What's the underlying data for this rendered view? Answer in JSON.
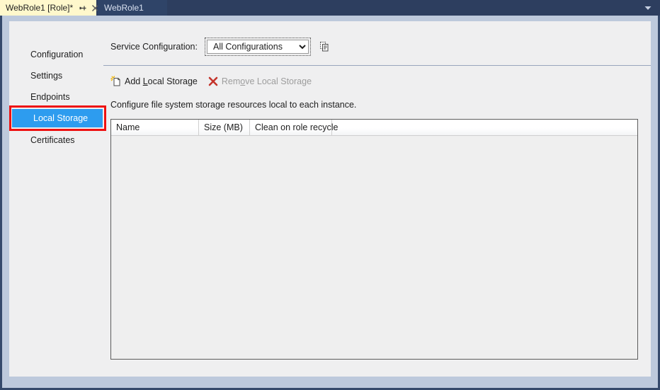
{
  "window": {
    "tabs": [
      {
        "label": "WebRole1 [Role]*",
        "active": true,
        "pin_icon": "pin-icon",
        "close_icon": "close-icon"
      },
      {
        "label": "WebRole1",
        "active": false
      }
    ],
    "overflow_icon": "chevron-down-icon"
  },
  "left_nav": {
    "items": [
      {
        "label": "Configuration",
        "selected": false
      },
      {
        "label": "Settings",
        "selected": false
      },
      {
        "label": "Endpoints",
        "selected": false
      },
      {
        "label": "Local Storage",
        "selected": true
      },
      {
        "label": "Certificates",
        "selected": false
      }
    ],
    "selected_highlight_color": "#2d9cef",
    "annotation_color": "#ee1111"
  },
  "service_configuration": {
    "label": "Service Configuration:",
    "selected_value": "All Configurations",
    "options": [
      "All Configurations"
    ],
    "copy_icon": "copy-icon"
  },
  "toolbar": {
    "add_label_prefix": "Add ",
    "add_label_accel": "L",
    "add_label_suffix": "ocal Storage",
    "add_icon": "add-document-icon",
    "remove_label_prefix": "Rem",
    "remove_label_accel": "o",
    "remove_label_suffix": "ve Local Storage",
    "remove_icon": "red-x-icon",
    "remove_enabled": false
  },
  "description": "Configure file system storage resources local to each instance.",
  "grid": {
    "columns": [
      "Name",
      "Size (MB)",
      "Clean on role recycle"
    ],
    "rows": []
  }
}
